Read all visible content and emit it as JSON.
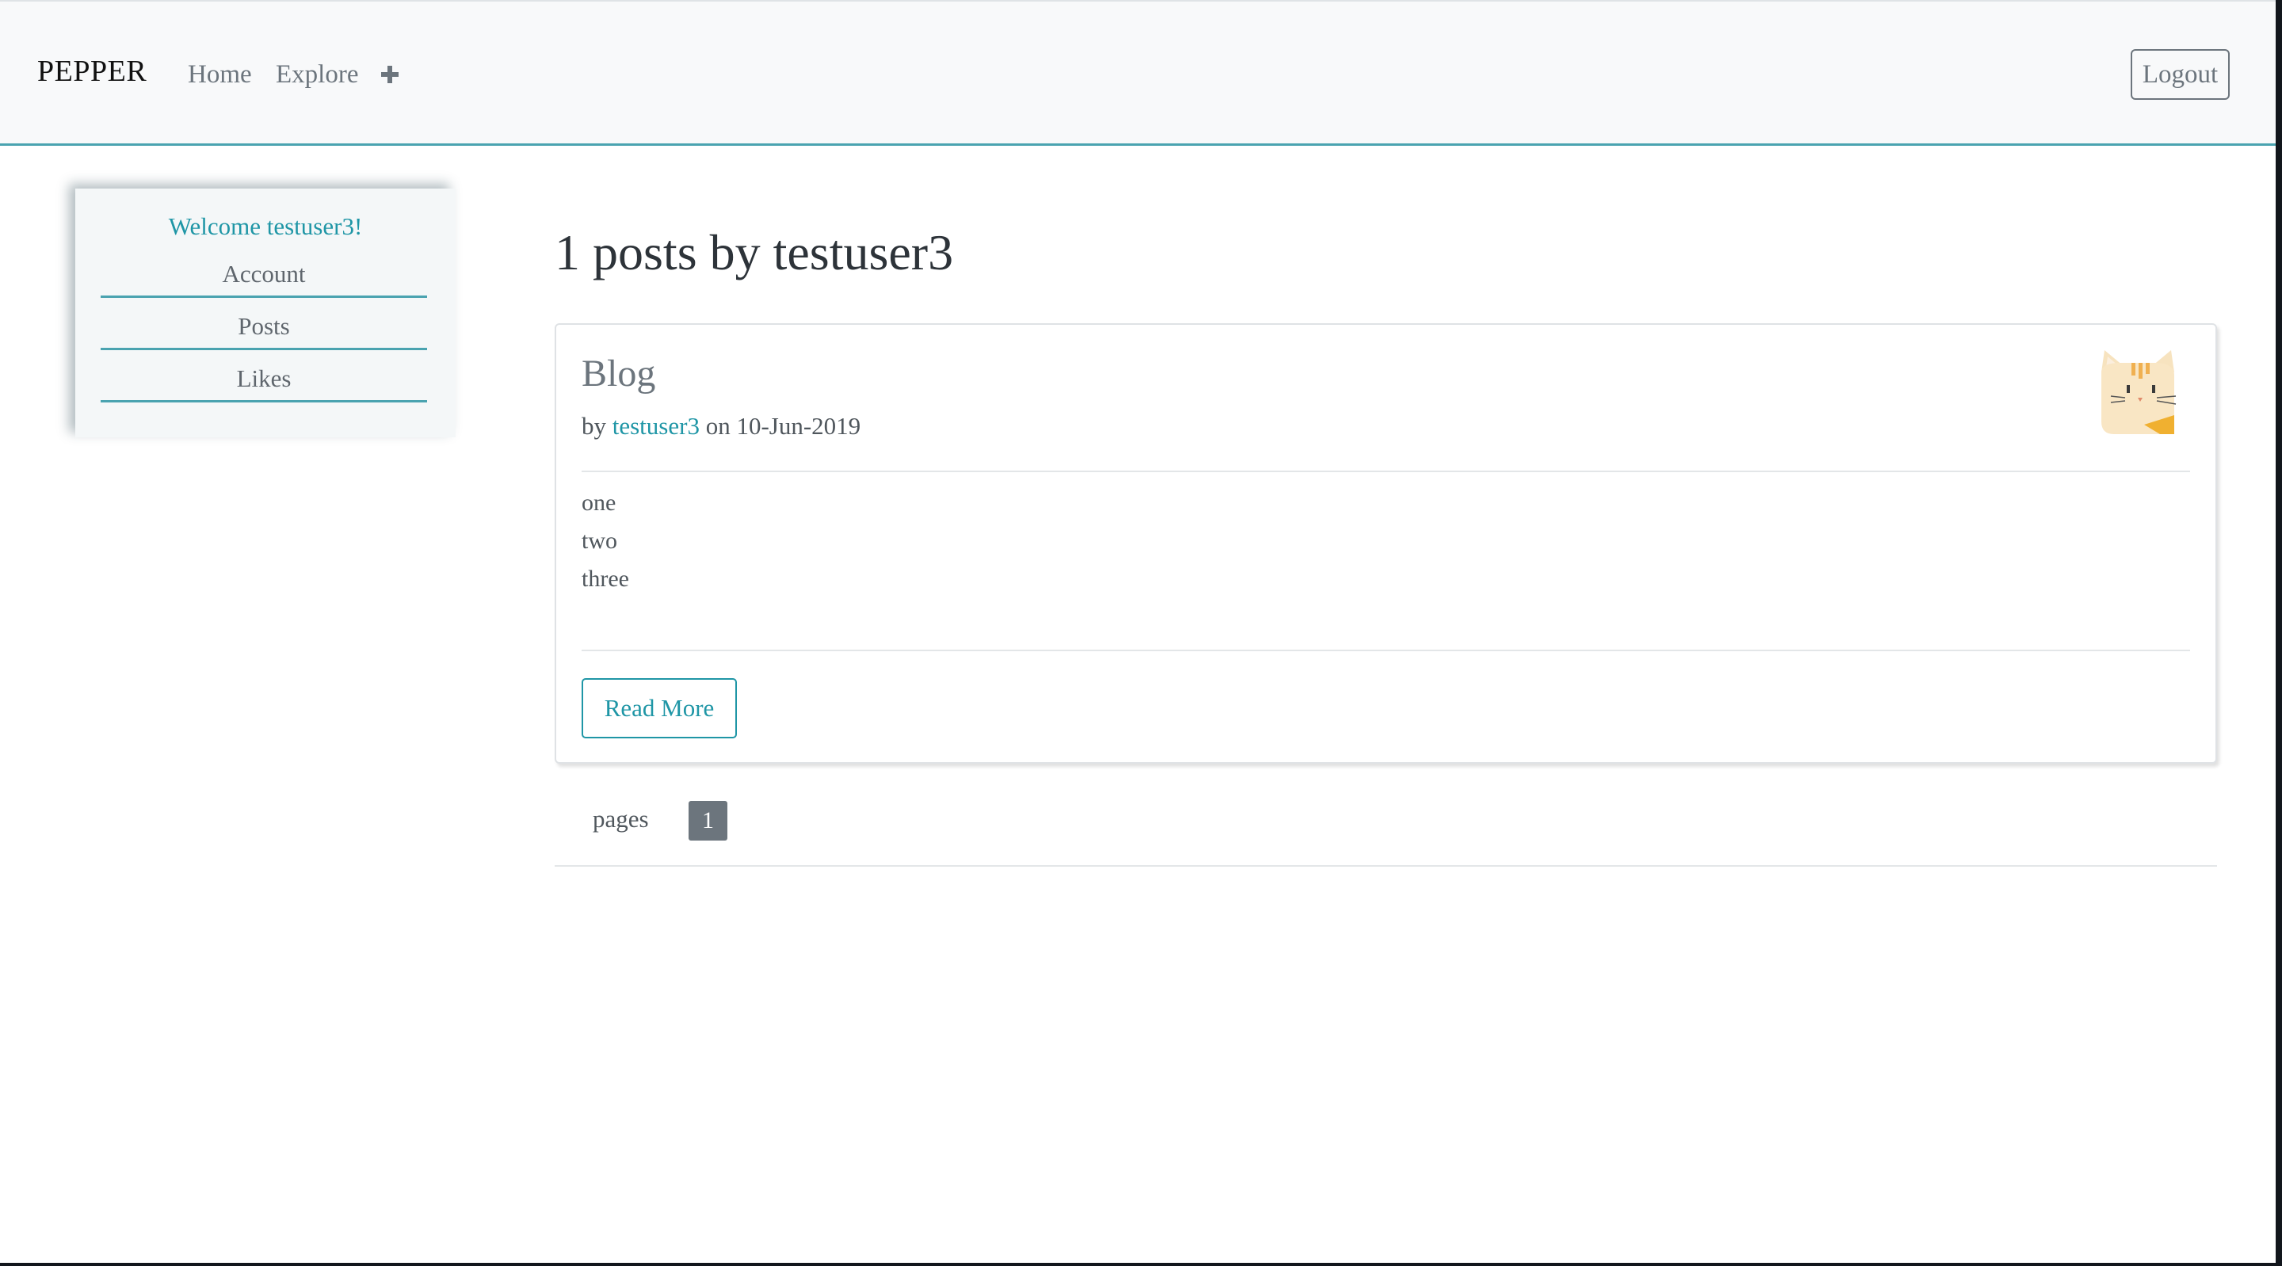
{
  "navbar": {
    "brand": "PEPPER",
    "links": [
      "Home",
      "Explore"
    ],
    "add_icon": "plus-icon",
    "logout_label": "Logout"
  },
  "sidebar": {
    "welcome": "Welcome testuser3!",
    "items": [
      "Account",
      "Posts",
      "Likes"
    ]
  },
  "main": {
    "title": "1 posts by testuser3",
    "post": {
      "title": "Blog",
      "by_prefix": "by",
      "author": "testuser3",
      "date_prefix": "on",
      "date": "10-Jun-2019",
      "body": [
        "one",
        "two",
        "three"
      ],
      "read_more_label": "Read More",
      "avatar_icon": "cat-avatar-icon"
    },
    "pagination": {
      "label": "pages",
      "current_page": "1"
    }
  },
  "colors": {
    "accent": "#1f96a6",
    "navbar_bg": "#f8f9fa",
    "muted": "#6c757d"
  }
}
